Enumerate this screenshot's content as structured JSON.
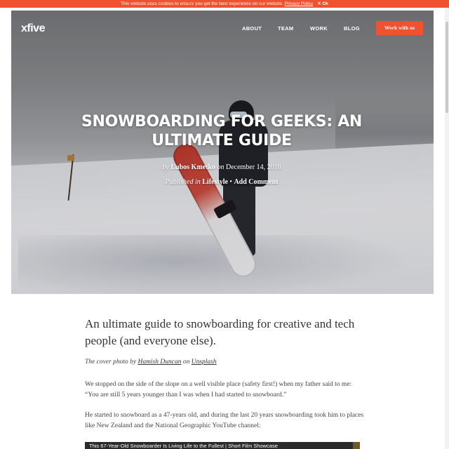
{
  "cookie": {
    "message": "This website uses cookies to ensure you get the best experience on our website.",
    "policy_link": "Privacy Policy",
    "ok_label": "✕ Ok"
  },
  "header": {
    "logo": "xfive",
    "nav": [
      "ABOUT",
      "TEAM",
      "WORK",
      "BLOG"
    ],
    "cta": "Work with us"
  },
  "hero": {
    "title": "SNOWBOARDING FOR GEEKS: AN ULTIMATE GUIDE",
    "by_prefix": "by",
    "author": "Lubos Kmetko",
    "date_prefix": "on",
    "date": "December 14, 2018",
    "published_prefix": "Published in",
    "category": "Lifestyle",
    "separator": "•",
    "comment_link": "Add Comment"
  },
  "article": {
    "lead": "An ultimate guide to snowboarding for creative and tech people (and everyone else).",
    "caption_prefix": "The cover photo by",
    "photographer": "Hamish Duncan",
    "caption_on": "on",
    "source": "Unsplash",
    "paragraph_1": "We stopped on the side of the slope on a well visible place (safety first!) when my father said to me: “You are still 5 years younger than I was when I had started to snowboard.”",
    "paragraph_2": "He started to snowboard as a 47-years old, and during the last 20 years snowboarding took him to places like New Zealand and the National Geographic YouTube channel:",
    "video_title": "This 67-Year-Old Snowboarder Is Living Life to the Fullest | Short Film Showcase"
  },
  "colors": {
    "accent": "#f0512e"
  }
}
